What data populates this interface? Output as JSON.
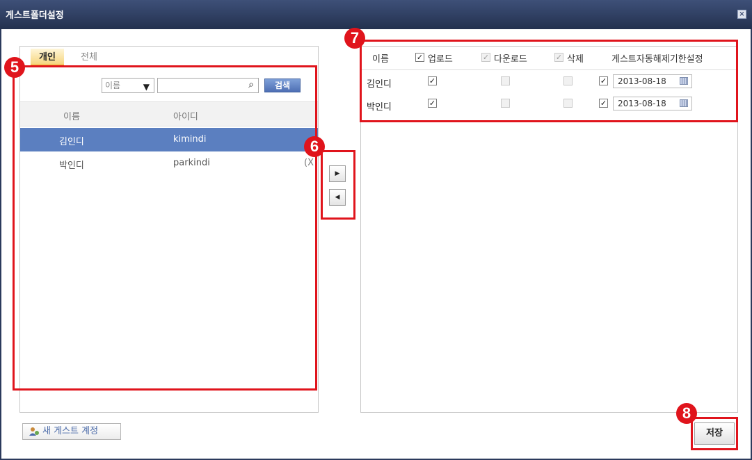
{
  "window": {
    "title": "게스트폴더설정",
    "close_icon": "close-icon"
  },
  "left": {
    "tabs": [
      {
        "label": "개인",
        "active": true
      },
      {
        "label": "전체",
        "active": false
      }
    ],
    "search": {
      "select_value": "이름",
      "input_value": "",
      "button_label": "검색"
    },
    "columns": [
      "이름",
      "아이디"
    ],
    "rows": [
      {
        "name": "김인디",
        "id": "kimindi",
        "extra": "",
        "selected": true
      },
      {
        "name": "박인디",
        "id": "parkindi",
        "extra": "(X",
        "selected": false
      }
    ],
    "new_guest_button": "새 게스트 계정"
  },
  "arrows": {
    "add": "▶",
    "remove": "◀"
  },
  "right": {
    "columns": {
      "name": "이름",
      "upload": "업로드",
      "download": "다운로드",
      "delete": "삭제",
      "expiry": "게스트자동해제기한설정"
    },
    "header_checks": {
      "upload": true,
      "download": true,
      "delete": true
    },
    "rows": [
      {
        "name": "김인디",
        "upload": true,
        "download": false,
        "delete": false,
        "expiry_enabled": true,
        "date": "2013-08-18"
      },
      {
        "name": "박인디",
        "upload": true,
        "download": false,
        "delete": false,
        "expiry_enabled": true,
        "date": "2013-08-18"
      }
    ]
  },
  "save_button": "저장",
  "annotations": {
    "b5": "5",
    "b6": "6",
    "b7": "7",
    "b8": "8",
    "color": "#e0141c"
  },
  "colors": {
    "titlebar": "#2b3a5c",
    "selected_row": "#5b7fc0",
    "search_button": "#4e6fb4",
    "tab_active": "#f6d57d"
  }
}
